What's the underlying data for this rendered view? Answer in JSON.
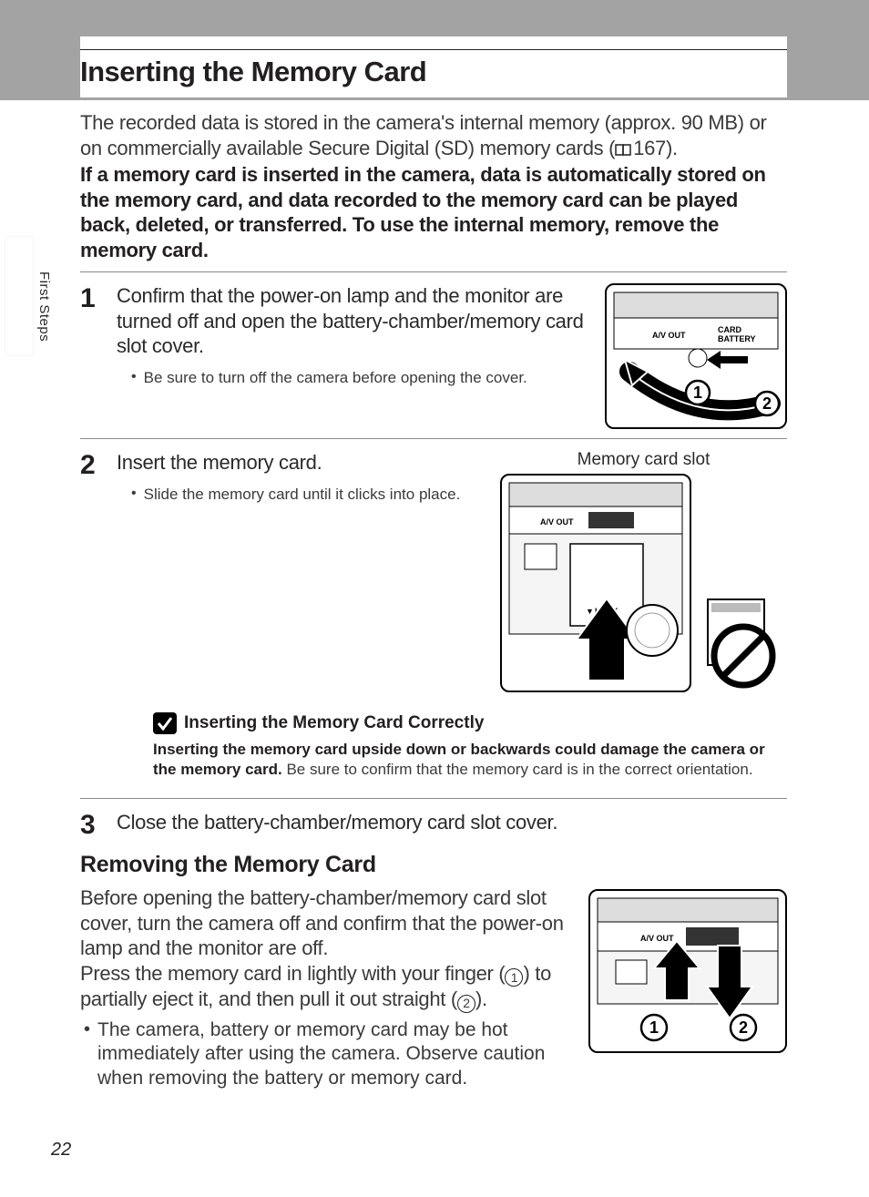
{
  "tab_label": "First Steps",
  "page_number": "22",
  "section_title": "Inserting the Memory Card",
  "intro_text_1": "The recorded data is stored in the camera's internal memory (approx. 90 MB) or on commercially available Secure Digital (SD) memory cards (",
  "intro_ref": "167).",
  "intro_bold": "If a memory card is inserted in the camera, data is automatically stored on the memory card, and data recorded to the memory card can be played back, deleted, or transferred. To use the internal memory, remove the memory card.",
  "steps": [
    {
      "num": "1",
      "head": "Confirm that the power-on lamp and the monitor are turned off and open the battery-chamber/memory card slot cover.",
      "bullet": "Be sure to turn off the camera before opening the cover."
    },
    {
      "num": "2",
      "head": "Insert the memory card.",
      "bullet": "Slide the memory card until it clicks into place.",
      "callout": "Memory card slot"
    },
    {
      "num": "3",
      "head": "Close the battery-chamber/memory card slot cover."
    }
  ],
  "note": {
    "title": "Inserting the Memory Card Correctly",
    "bold": "Inserting the memory card upside down or backwards could damage the camera or the memory card.",
    "rest": " Be sure to confirm that the memory card is in the correct orientation."
  },
  "subsection_title": "Removing the Memory Card",
  "sub_para_1a": "Before opening the battery-chamber/memory card slot cover, turn the camera off and confirm that the power-on lamp and the monitor are off.",
  "sub_para_2a": "Press the memory card in lightly with your finger (",
  "sub_para_2b": ") to partially eject it, and then pull it out straight (",
  "sub_para_2c": ").",
  "sub_bullet": "The camera, battery or memory card may be hot immediately after using the camera. Observe caution when removing the battery or memory card.",
  "illus_labels": {
    "av_out": "A/V OUT",
    "card": "CARD",
    "battery": "BATTERY",
    "lock": "LOCK"
  }
}
